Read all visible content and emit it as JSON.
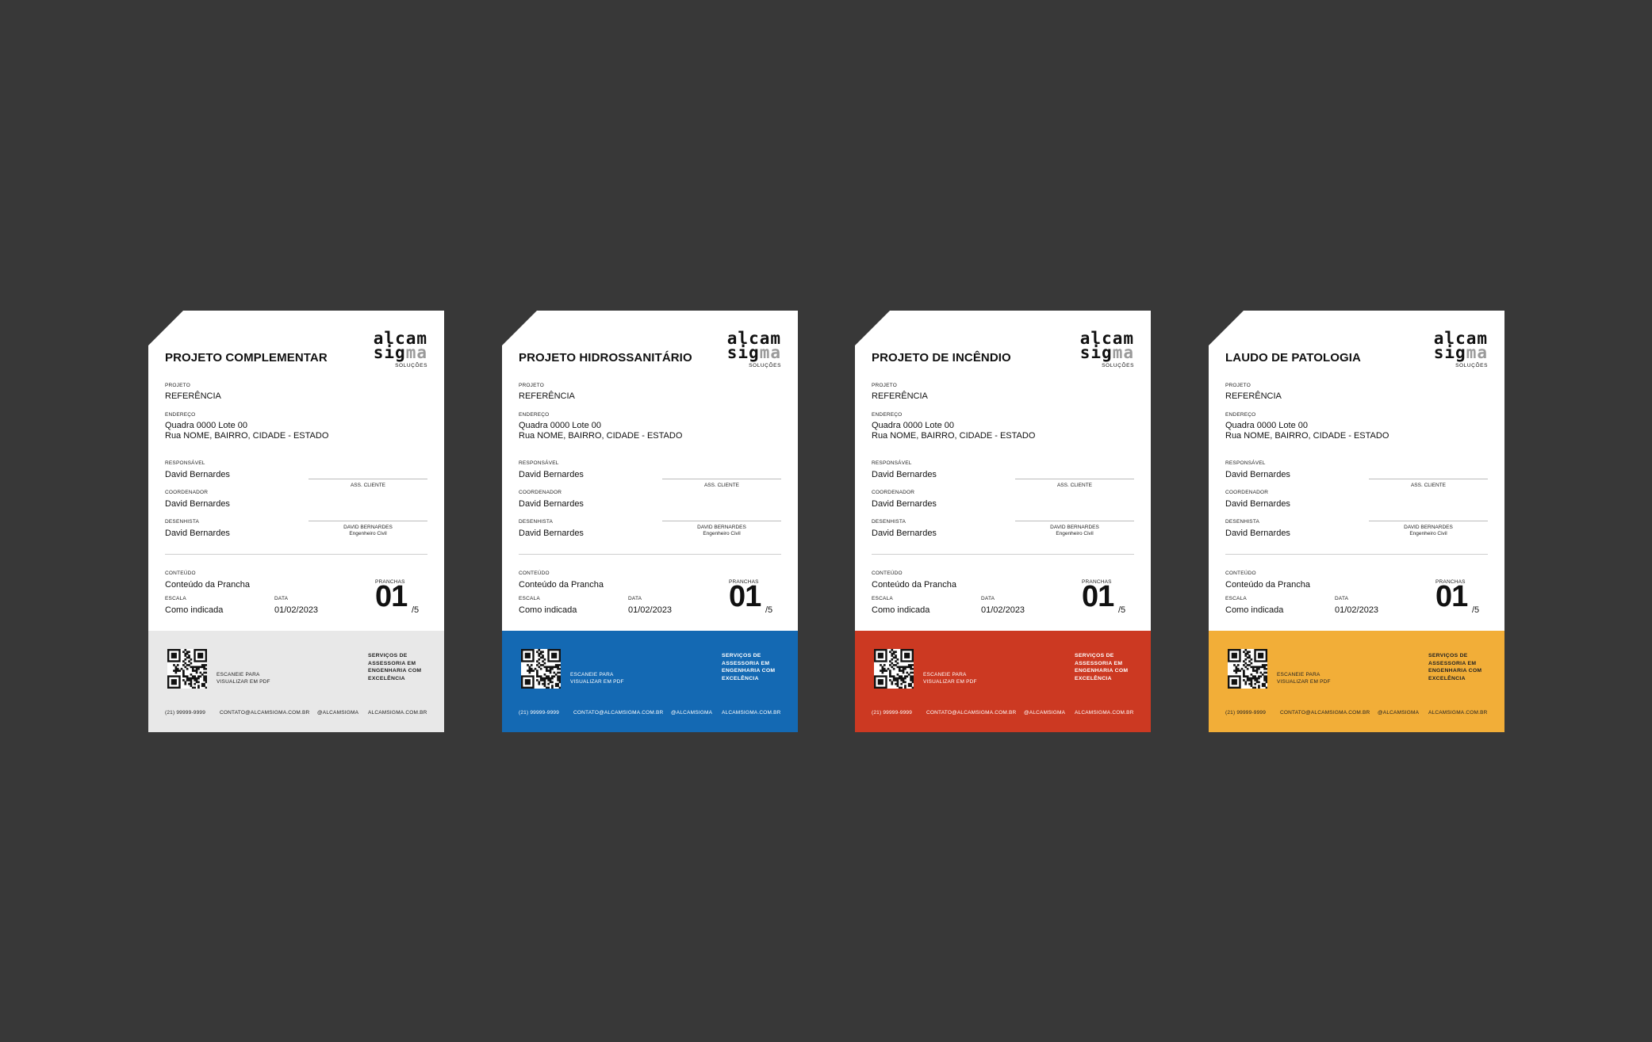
{
  "logo": {
    "line1": "alcam",
    "line2a": "sig",
    "line2b": "ma",
    "sub": "SOLUÇÕES"
  },
  "cards": [
    {
      "title": "PROJETO COMPLEMENTAR",
      "footer_color": "#e8e8e8",
      "footer_text": "#222222"
    },
    {
      "title": "PROJETO HIDROSSANITÁRIO",
      "footer_color": "#1469b3",
      "footer_text": "#ffffff"
    },
    {
      "title": "PROJETO DE INCÊNDIO",
      "footer_color": "#cc3922",
      "footer_text": "#ffffff"
    },
    {
      "title": "LAUDO DE PATOLOGIA",
      "footer_color": "#f2ae38",
      "footer_text": "#222222"
    }
  ],
  "fields": {
    "projeto_label": "PROJETO",
    "projeto_value": "REFERÊNCIA",
    "endereco_label": "ENDEREÇO",
    "endereco_line1": "Quadra 0000 Lote 00",
    "endereco_line2": "Rua NOME, BAIRRO, CIDADE - ESTADO",
    "responsavel_label": "RESPONSÁVEL",
    "responsavel_value": "David Bernardes",
    "coordenador_label": "COORDENADOR",
    "coordenador_value": "David Bernardes",
    "desenhista_label": "DESENHISTA",
    "desenhista_value": "David Bernardes",
    "ass_cliente": "ASS. CLIENTE",
    "signer_name": "DAVID BERNARDES",
    "signer_role": "Engenheiro Civil",
    "conteudo_label": "CONTEÚDO",
    "conteudo_value": "Conteúdo da Prancha",
    "escala_label": "ESCALA",
    "escala_value": "Como indicada",
    "data_label": "DATA",
    "data_value": "01/02/2023",
    "pranchas_label": "PRANCHAS",
    "pranchas_num": "01",
    "pranchas_total": "/5"
  },
  "footer": {
    "scan_line1": "ESCANEIE PARA",
    "scan_line2": "VISUALIZAR EM PDF",
    "serv_line1": "SERVIÇOS DE",
    "serv_line2": "ASSESSORIA EM",
    "serv_line3": "ENGENHARIA COM",
    "serv_line4": "EXCELÊNCIA",
    "phone": "(21) 99999-9999",
    "email": "CONTATO@ALCAMSIGMA.COM.BR",
    "social": "@ALCAMSIGMA",
    "site": "ALCAMSIGMA.COM.BR"
  }
}
